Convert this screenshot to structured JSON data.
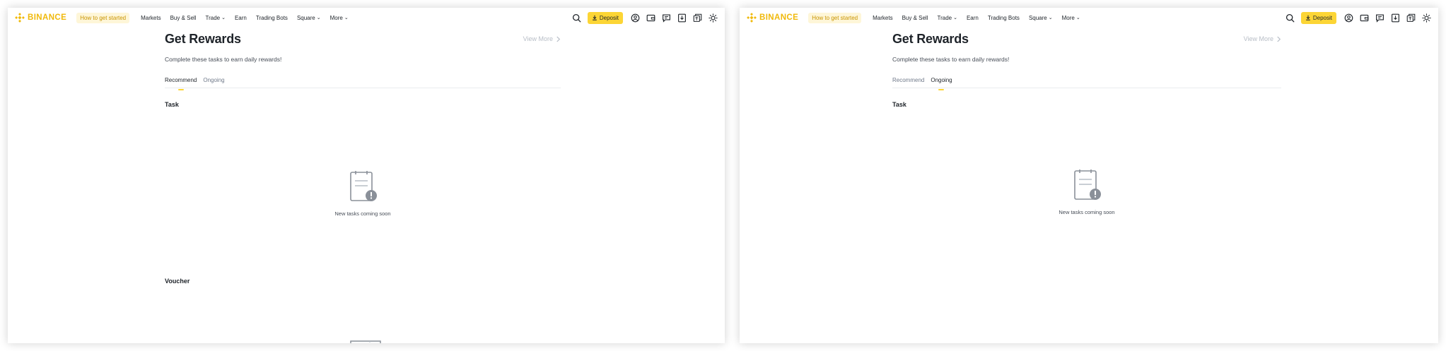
{
  "colors": {
    "brand": "#f0b90b",
    "deposit_bg": "#fcd535",
    "promo_bg": "#fef6d8",
    "promo_text": "#c99400",
    "muted_text": "#b7bdc6"
  },
  "header": {
    "logo_text": "BINANCE",
    "promo_label": "How to get started",
    "nav": [
      {
        "label": "Markets",
        "has_dropdown": false
      },
      {
        "label": "Buy & Sell",
        "has_dropdown": false
      },
      {
        "label": "Trade",
        "has_dropdown": true
      },
      {
        "label": "Earn",
        "has_dropdown": false
      },
      {
        "label": "Trading Bots",
        "has_dropdown": false
      },
      {
        "label": "Square",
        "has_dropdown": true
      },
      {
        "label": "More",
        "has_dropdown": true
      }
    ],
    "deposit_label": "Deposit",
    "icons": [
      "search-icon",
      "deposit-arrow-icon",
      "user-icon",
      "wallet-icon",
      "messages-icon",
      "download-icon",
      "language-icon",
      "theme-sun-icon"
    ]
  },
  "panels": [
    {
      "page_title": "Get Rewards",
      "view_more": "View More",
      "subtitle": "Complete these tasks to earn daily rewards!",
      "tabs": [
        {
          "label": "Recommend",
          "active": true
        },
        {
          "label": "Ongoing",
          "active": false
        }
      ],
      "section_task": "Task",
      "empty_text": "New tasks coming soon",
      "section_voucher": "Voucher"
    },
    {
      "page_title": "Get Rewards",
      "view_more": "View More",
      "subtitle": "Complete these tasks to earn daily rewards!",
      "tabs": [
        {
          "label": "Recommend",
          "active": false
        },
        {
          "label": "Ongoing",
          "active": true
        }
      ],
      "section_task": "Task",
      "empty_text": "New tasks coming soon"
    }
  ]
}
